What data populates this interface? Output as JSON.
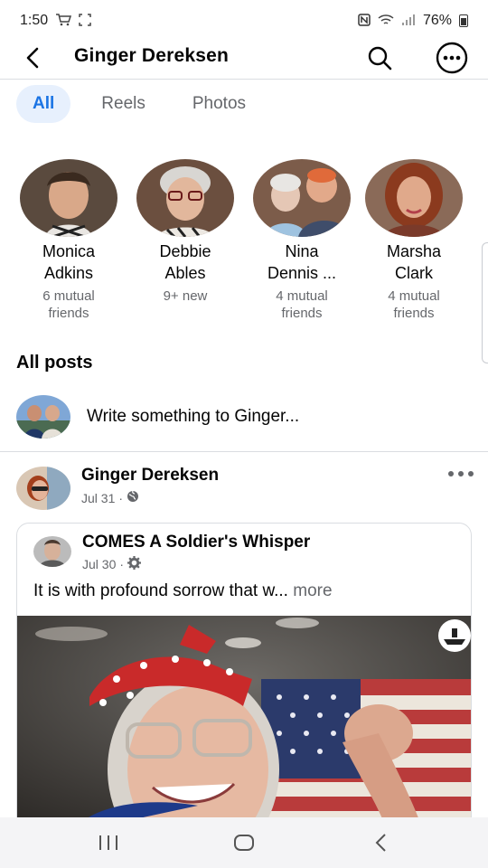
{
  "status_bar": {
    "time": "1:50",
    "battery": "76%",
    "icons": [
      "cart-icon",
      "screenshot-icon",
      "nfc-icon",
      "wifi-icon",
      "signal-icon",
      "battery-icon"
    ]
  },
  "header": {
    "title": "Ginger Dereksen",
    "icons": [
      "back-arrow-icon",
      "search-icon",
      "more-icon"
    ]
  },
  "tabs": [
    {
      "label": "All",
      "active": true
    },
    {
      "label": "Reels",
      "active": false
    },
    {
      "label": "Photos",
      "active": false
    }
  ],
  "friends": [
    {
      "name_line1": "Monica",
      "name_line2": "Adkins",
      "sub_line1": "6 mutual",
      "sub_line2": "friends"
    },
    {
      "name_line1": "Debbie",
      "name_line2": "Ables",
      "sub_line1": "9+ new",
      "sub_line2": ""
    },
    {
      "name_line1": "Nina",
      "name_line2": "Dennis ...",
      "sub_line1": "4 mutual",
      "sub_line2": "friends"
    },
    {
      "name_line1": "Marsha",
      "name_line2": "Clark",
      "sub_line1": "4 mutual",
      "sub_line2": "friends"
    }
  ],
  "posts_section": {
    "title": "All posts",
    "composer_placeholder": "Write something to Ginger..."
  },
  "post": {
    "author": "Ginger Dereksen",
    "date": "Jul 31",
    "privacy_icon": "globe-icon",
    "shared": {
      "author": "COMES A Soldier's Whisper",
      "date": "Jul 30",
      "privacy_icon": "gear-icon",
      "text": "It is with profound sorrow that w...",
      "more_label": "more"
    }
  },
  "colors": {
    "accent": "#1b74e4",
    "tab_active_bg": "#e7f0fd",
    "secondary_text": "#65676b",
    "divider": "#dadde1"
  }
}
